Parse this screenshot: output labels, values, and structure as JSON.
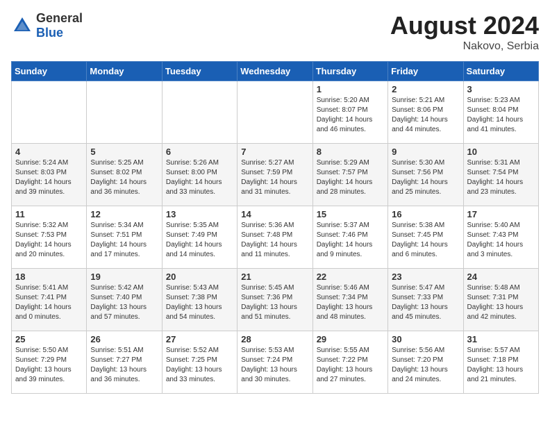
{
  "header": {
    "logo_general": "General",
    "logo_blue": "Blue",
    "month_year": "August 2024",
    "location": "Nakovo, Serbia"
  },
  "days_of_week": [
    "Sunday",
    "Monday",
    "Tuesday",
    "Wednesday",
    "Thursday",
    "Friday",
    "Saturday"
  ],
  "weeks": [
    [
      {
        "day": "",
        "info": ""
      },
      {
        "day": "",
        "info": ""
      },
      {
        "day": "",
        "info": ""
      },
      {
        "day": "",
        "info": ""
      },
      {
        "day": "1",
        "info": "Sunrise: 5:20 AM\nSunset: 8:07 PM\nDaylight: 14 hours\nand 46 minutes."
      },
      {
        "day": "2",
        "info": "Sunrise: 5:21 AM\nSunset: 8:06 PM\nDaylight: 14 hours\nand 44 minutes."
      },
      {
        "day": "3",
        "info": "Sunrise: 5:23 AM\nSunset: 8:04 PM\nDaylight: 14 hours\nand 41 minutes."
      }
    ],
    [
      {
        "day": "4",
        "info": "Sunrise: 5:24 AM\nSunset: 8:03 PM\nDaylight: 14 hours\nand 39 minutes."
      },
      {
        "day": "5",
        "info": "Sunrise: 5:25 AM\nSunset: 8:02 PM\nDaylight: 14 hours\nand 36 minutes."
      },
      {
        "day": "6",
        "info": "Sunrise: 5:26 AM\nSunset: 8:00 PM\nDaylight: 14 hours\nand 33 minutes."
      },
      {
        "day": "7",
        "info": "Sunrise: 5:27 AM\nSunset: 7:59 PM\nDaylight: 14 hours\nand 31 minutes."
      },
      {
        "day": "8",
        "info": "Sunrise: 5:29 AM\nSunset: 7:57 PM\nDaylight: 14 hours\nand 28 minutes."
      },
      {
        "day": "9",
        "info": "Sunrise: 5:30 AM\nSunset: 7:56 PM\nDaylight: 14 hours\nand 25 minutes."
      },
      {
        "day": "10",
        "info": "Sunrise: 5:31 AM\nSunset: 7:54 PM\nDaylight: 14 hours\nand 23 minutes."
      }
    ],
    [
      {
        "day": "11",
        "info": "Sunrise: 5:32 AM\nSunset: 7:53 PM\nDaylight: 14 hours\nand 20 minutes."
      },
      {
        "day": "12",
        "info": "Sunrise: 5:34 AM\nSunset: 7:51 PM\nDaylight: 14 hours\nand 17 minutes."
      },
      {
        "day": "13",
        "info": "Sunrise: 5:35 AM\nSunset: 7:49 PM\nDaylight: 14 hours\nand 14 minutes."
      },
      {
        "day": "14",
        "info": "Sunrise: 5:36 AM\nSunset: 7:48 PM\nDaylight: 14 hours\nand 11 minutes."
      },
      {
        "day": "15",
        "info": "Sunrise: 5:37 AM\nSunset: 7:46 PM\nDaylight: 14 hours\nand 9 minutes."
      },
      {
        "day": "16",
        "info": "Sunrise: 5:38 AM\nSunset: 7:45 PM\nDaylight: 14 hours\nand 6 minutes."
      },
      {
        "day": "17",
        "info": "Sunrise: 5:40 AM\nSunset: 7:43 PM\nDaylight: 14 hours\nand 3 minutes."
      }
    ],
    [
      {
        "day": "18",
        "info": "Sunrise: 5:41 AM\nSunset: 7:41 PM\nDaylight: 14 hours\nand 0 minutes."
      },
      {
        "day": "19",
        "info": "Sunrise: 5:42 AM\nSunset: 7:40 PM\nDaylight: 13 hours\nand 57 minutes."
      },
      {
        "day": "20",
        "info": "Sunrise: 5:43 AM\nSunset: 7:38 PM\nDaylight: 13 hours\nand 54 minutes."
      },
      {
        "day": "21",
        "info": "Sunrise: 5:45 AM\nSunset: 7:36 PM\nDaylight: 13 hours\nand 51 minutes."
      },
      {
        "day": "22",
        "info": "Sunrise: 5:46 AM\nSunset: 7:34 PM\nDaylight: 13 hours\nand 48 minutes."
      },
      {
        "day": "23",
        "info": "Sunrise: 5:47 AM\nSunset: 7:33 PM\nDaylight: 13 hours\nand 45 minutes."
      },
      {
        "day": "24",
        "info": "Sunrise: 5:48 AM\nSunset: 7:31 PM\nDaylight: 13 hours\nand 42 minutes."
      }
    ],
    [
      {
        "day": "25",
        "info": "Sunrise: 5:50 AM\nSunset: 7:29 PM\nDaylight: 13 hours\nand 39 minutes."
      },
      {
        "day": "26",
        "info": "Sunrise: 5:51 AM\nSunset: 7:27 PM\nDaylight: 13 hours\nand 36 minutes."
      },
      {
        "day": "27",
        "info": "Sunrise: 5:52 AM\nSunset: 7:25 PM\nDaylight: 13 hours\nand 33 minutes."
      },
      {
        "day": "28",
        "info": "Sunrise: 5:53 AM\nSunset: 7:24 PM\nDaylight: 13 hours\nand 30 minutes."
      },
      {
        "day": "29",
        "info": "Sunrise: 5:55 AM\nSunset: 7:22 PM\nDaylight: 13 hours\nand 27 minutes."
      },
      {
        "day": "30",
        "info": "Sunrise: 5:56 AM\nSunset: 7:20 PM\nDaylight: 13 hours\nand 24 minutes."
      },
      {
        "day": "31",
        "info": "Sunrise: 5:57 AM\nSunset: 7:18 PM\nDaylight: 13 hours\nand 21 minutes."
      }
    ]
  ]
}
